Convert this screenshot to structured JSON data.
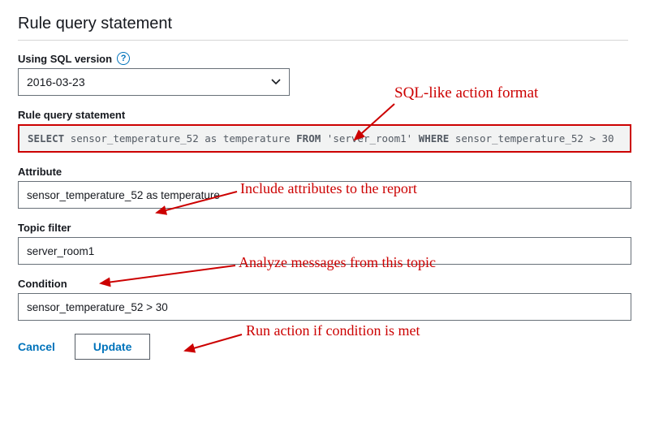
{
  "heading": "Rule query statement",
  "sql_version": {
    "label": "Using SQL version",
    "selected": "2016-03-23"
  },
  "query": {
    "label": "Rule query statement",
    "keywords": {
      "select": "SELECT",
      "from": "FROM",
      "where": "WHERE"
    },
    "select_expr": "sensor_temperature_52 as temperature",
    "topic_literal": "'server_room1'",
    "where_expr": "sensor_temperature_52 > 30"
  },
  "attribute": {
    "label": "Attribute",
    "value": "sensor_temperature_52 as temperature"
  },
  "topic_filter": {
    "label": "Topic filter",
    "value": "server_room1"
  },
  "condition": {
    "label": "Condition",
    "value": "sensor_temperature_52 > 30"
  },
  "buttons": {
    "cancel": "Cancel",
    "update": "Update"
  },
  "annotations": {
    "sql_format": "SQL-like action format",
    "attributes": "Include attributes to the report",
    "topic": "Analyze messages from this topic",
    "condition": "Run action if condition is met"
  },
  "colors": {
    "accent": "#0073bb",
    "annotation": "#cc0000"
  }
}
